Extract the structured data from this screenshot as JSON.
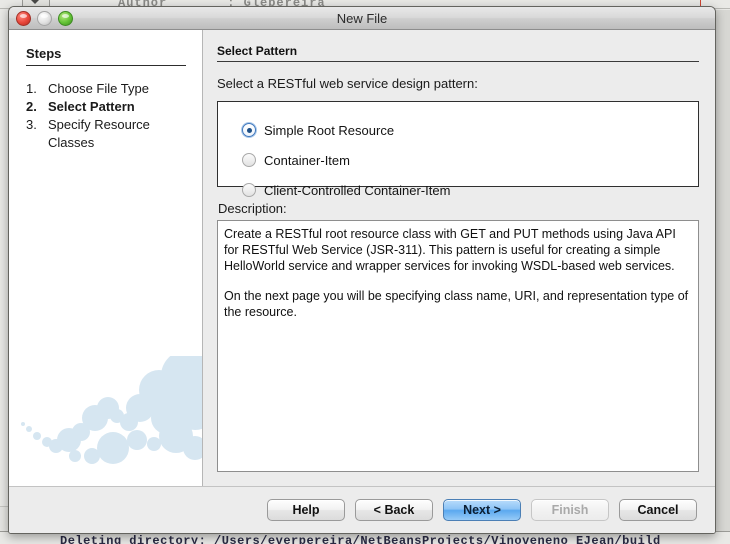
{
  "background": {
    "top_text_left": "Author",
    "top_text_right": ": Glepereira",
    "bottom_text": "Deleting directory: /Users/everpereira/NetBeansProjects/Vinoveneno_EJean/build"
  },
  "window": {
    "title": "New File",
    "traffic_lights": {
      "close": "close-button",
      "minimize": "minimize-button",
      "zoom": "zoom-button"
    }
  },
  "steps": {
    "heading": "Steps",
    "items": [
      {
        "num": "1.",
        "label": "Choose File Type",
        "current": false
      },
      {
        "num": "2.",
        "label": "Select Pattern",
        "current": true
      },
      {
        "num": "3.",
        "label": "Specify Resource Classes",
        "current": false
      }
    ]
  },
  "content": {
    "section_title": "Select Pattern",
    "prompt": "Select a RESTful web service design pattern:",
    "patterns": [
      {
        "label": "Simple Root Resource",
        "selected": true
      },
      {
        "label": "Container-Item",
        "selected": false
      },
      {
        "label": "Client-Controlled Container-Item",
        "selected": false
      }
    ],
    "description_label": "Description:",
    "description_paragraphs": [
      "Create a RESTful root resource class with GET and PUT methods using Java API for RESTful Web Service (JSR-311). This pattern is useful for creating a simple HelloWorld service and wrapper services for invoking WSDL-based web services.",
      "On the next page you will be specifying class name, URI, and representation type of the resource."
    ]
  },
  "footer": {
    "buttons": [
      {
        "label": "Help",
        "state": "normal"
      },
      {
        "label": "< Back",
        "state": "normal"
      },
      {
        "label": "Next >",
        "state": "default"
      },
      {
        "label": "Finish",
        "state": "disabled"
      },
      {
        "label": "Cancel",
        "state": "normal"
      }
    ]
  },
  "colors": {
    "accent_blue": "#5aa8ef",
    "radio_selected": "#1d4f86",
    "window_bg": "#ececec",
    "sidebar_bg": "#ffffff",
    "watermark_blue": "#c5dcec"
  }
}
